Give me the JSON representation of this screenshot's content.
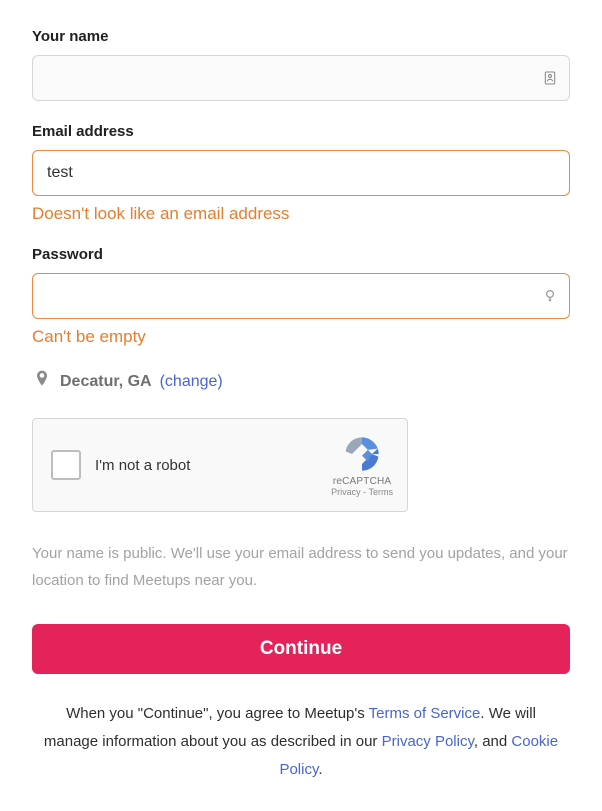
{
  "form": {
    "name": {
      "label": "Your name",
      "value": ""
    },
    "email": {
      "label": "Email address",
      "value": "test",
      "error": "Doesn't look like an email address"
    },
    "password": {
      "label": "Password",
      "value": "",
      "error": "Can't be empty"
    }
  },
  "location": {
    "text": "Decatur, GA",
    "change_label": "(change)"
  },
  "recaptcha": {
    "label": "I'm not a robot",
    "brand": "reCAPTCHA",
    "links": "Privacy - Terms"
  },
  "disclaimer": "Your name is public. We'll use your email address to send you updates, and your location to find Meetups near you.",
  "continue_label": "Continue",
  "terms": {
    "prefix": "When you \"Continue\", you agree to Meetup's ",
    "tos": "Terms of Service",
    "mid1": ". We will manage information about you as described in our ",
    "privacy": "Privacy Policy",
    "mid2": ", and ",
    "cookie": "Cookie Policy",
    "suffix": "."
  }
}
